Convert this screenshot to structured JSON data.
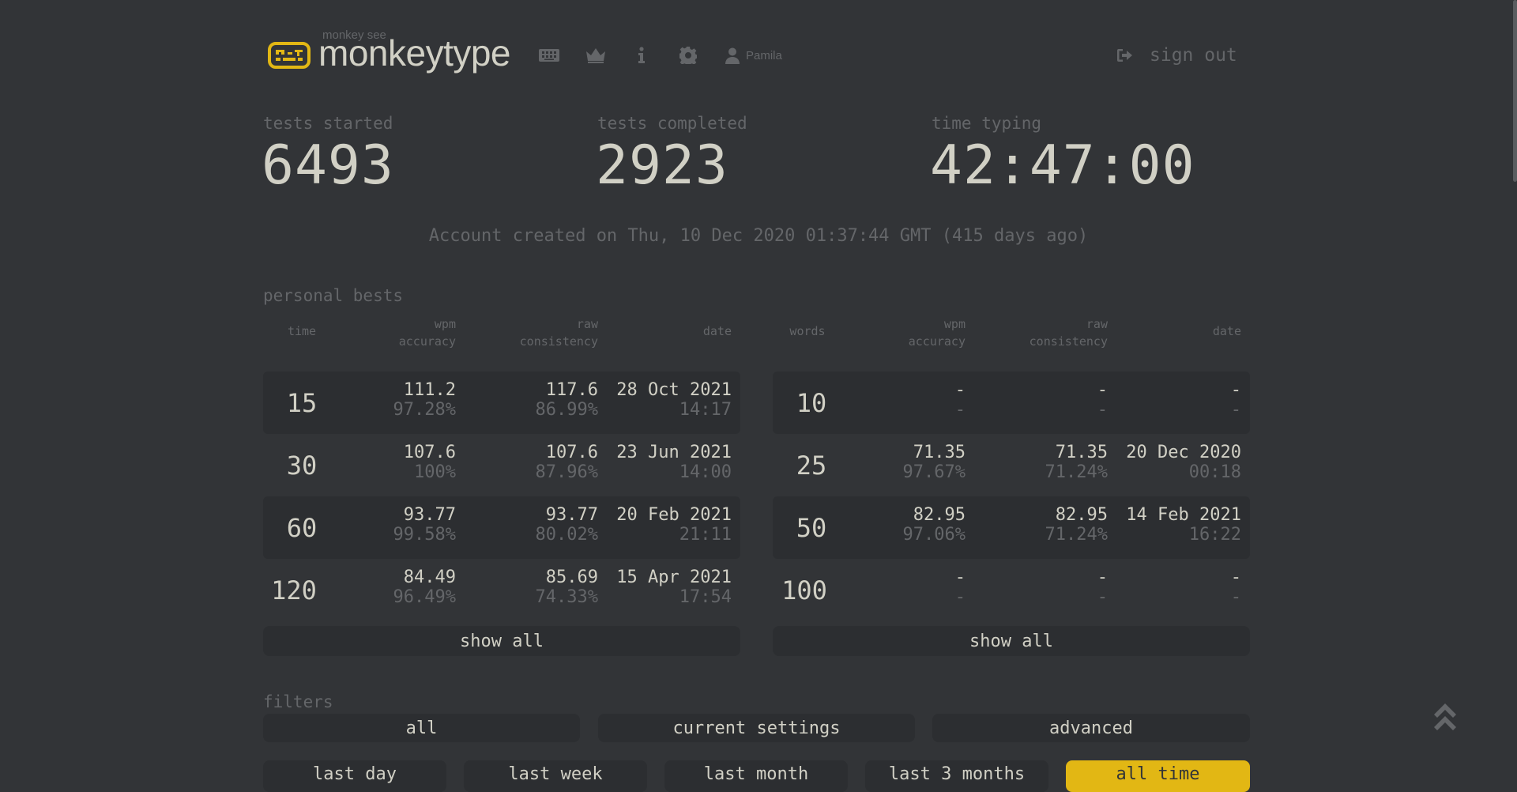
{
  "header": {
    "logo_small": "monkey see",
    "logo_text": "monkeytype",
    "nav": [
      {
        "name": "keyboard-icon"
      },
      {
        "name": "crown-icon"
      },
      {
        "name": "info-icon"
      },
      {
        "name": "gear-icon"
      }
    ],
    "user_name": "Pamila",
    "signout_label": "sign out"
  },
  "stats": {
    "tests_started_label": "tests started",
    "tests_started": "6493",
    "tests_completed_label": "tests completed",
    "tests_completed": "2923",
    "time_typing_label": "time typing",
    "time_typing": "42:47:00"
  },
  "account_created": "Account created on Thu, 10 Dec 2020 01:37:44 GMT (415 days ago)",
  "personal_bests": {
    "title": "personal bests",
    "time_table": {
      "headers": {
        "first": "time",
        "wpm": "wpm",
        "accuracy": "accuracy",
        "raw": "raw",
        "consistency": "consistency",
        "date": "date"
      },
      "rows": [
        {
          "key": "15",
          "wpm": "111.2",
          "acc": "97.28%",
          "raw": "117.6",
          "cons": "86.99%",
          "date": "28 Oct 2021",
          "time": "14:17"
        },
        {
          "key": "30",
          "wpm": "107.6",
          "acc": "100%",
          "raw": "107.6",
          "cons": "87.96%",
          "date": "23 Jun 2021",
          "time": "14:00"
        },
        {
          "key": "60",
          "wpm": "93.77",
          "acc": "99.58%",
          "raw": "93.77",
          "cons": "80.02%",
          "date": "20 Feb 2021",
          "time": "21:11"
        },
        {
          "key": "120",
          "wpm": "84.49",
          "acc": "96.49%",
          "raw": "85.69",
          "cons": "74.33%",
          "date": "15 Apr 2021",
          "time": "17:54"
        }
      ],
      "show_all": "show all"
    },
    "words_table": {
      "headers": {
        "first": "words",
        "wpm": "wpm",
        "accuracy": "accuracy",
        "raw": "raw",
        "consistency": "consistency",
        "date": "date"
      },
      "rows": [
        {
          "key": "10",
          "wpm": "-",
          "acc": "-",
          "raw": "-",
          "cons": "-",
          "date": "-",
          "time": "-"
        },
        {
          "key": "25",
          "wpm": "71.35",
          "acc": "97.67%",
          "raw": "71.35",
          "cons": "71.24%",
          "date": "20 Dec 2020",
          "time": "00:18"
        },
        {
          "key": "50",
          "wpm": "82.95",
          "acc": "97.06%",
          "raw": "82.95",
          "cons": "71.24%",
          "date": "14 Feb 2021",
          "time": "16:22"
        },
        {
          "key": "100",
          "wpm": "-",
          "acc": "-",
          "raw": "-",
          "cons": "-",
          "date": "-",
          "time": "-"
        }
      ],
      "show_all": "show all"
    }
  },
  "filters": {
    "title": "filters",
    "presets": [
      "all",
      "current settings",
      "advanced"
    ],
    "ranges": [
      "last day",
      "last week",
      "last month",
      "last 3 months",
      "all time"
    ],
    "active_range": "all time"
  },
  "colors": {
    "bg": "#323437",
    "main": "#e2b714",
    "text": "#d1d0c5",
    "sub": "#646669",
    "sub_alt": "#2c2e31"
  }
}
